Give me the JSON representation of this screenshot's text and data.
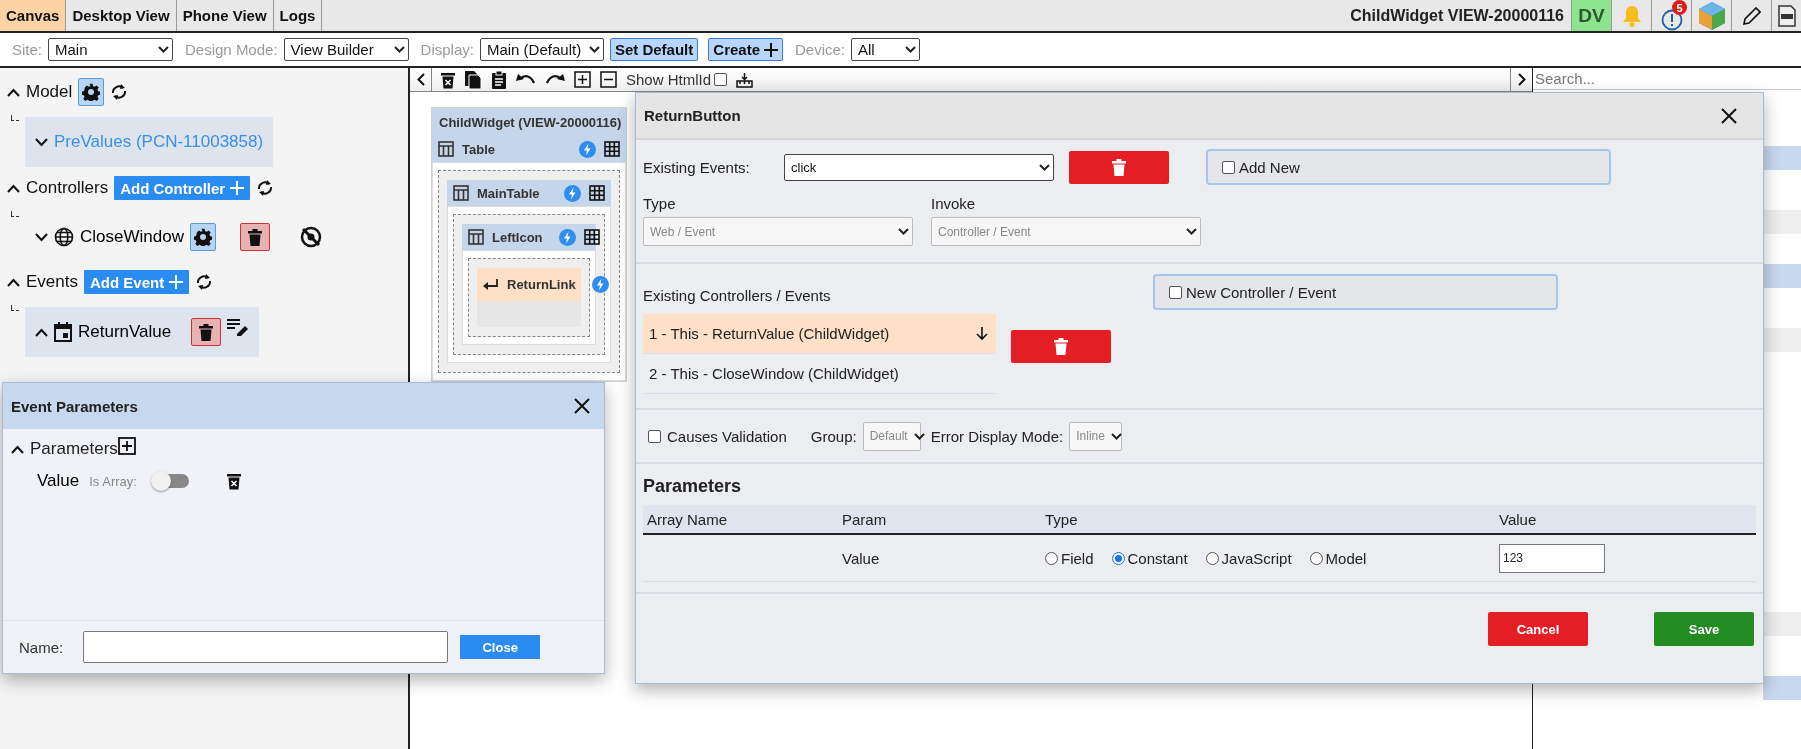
{
  "top_tabs": [
    {
      "label": "Canvas",
      "selected": true
    },
    {
      "label": "Desktop View",
      "selected": false
    },
    {
      "label": "Phone View",
      "selected": false
    },
    {
      "label": "Logs",
      "selected": false
    }
  ],
  "header": {
    "title": "ChildWidget VIEW-20000116",
    "user_initials": "DV",
    "alert_count": "5"
  },
  "options_bar": {
    "site": {
      "label": "Site:",
      "value": "Main"
    },
    "design_mode": {
      "label": "Design Mode:",
      "value": "View Builder"
    },
    "display": {
      "label": "Display:",
      "value": "Main (Default)"
    },
    "set_default": "Set Default",
    "create": "Create",
    "device": {
      "label": "Device:",
      "value": "All"
    }
  },
  "canvas_toolbar": {
    "show_htmlid": {
      "label": "Show HtmlId",
      "checked": false
    }
  },
  "left_panel": {
    "sections": [
      {
        "label": "Model",
        "expanded": true,
        "items": [
          {
            "label": "PreValues (PCN-11003858)",
            "expanded": false,
            "kind": "model"
          }
        ]
      },
      {
        "label": "Controllers",
        "expanded": true,
        "add_button": "Add Controller",
        "items": [
          {
            "label": "CloseWindow",
            "expanded": false,
            "kind": "controller"
          }
        ]
      },
      {
        "label": "Events",
        "expanded": true,
        "add_button": "Add Event",
        "items": [
          {
            "label": "ReturnValue",
            "expanded": true,
            "kind": "event"
          }
        ]
      }
    ]
  },
  "canvas": {
    "widget_title": "ChildWidget (VIEW-20000116)",
    "nodes": [
      {
        "label": "Table",
        "kind": "table",
        "children": [
          {
            "label": "MainTable",
            "kind": "table",
            "children": [
              {
                "label": "LeftIcon",
                "kind": "table",
                "children": [
                  {
                    "label": "ReturnLink",
                    "kind": "link"
                  }
                ]
              }
            ]
          }
        ]
      }
    ]
  },
  "right_panel": {
    "search": {
      "placeholder": "Search..."
    }
  },
  "event_parameters_dialog": {
    "title": "Event Parameters",
    "section": {
      "label": "Parameters",
      "expanded": true
    },
    "parameters": [
      {
        "name": "Value",
        "is_array_label": "Is Array:",
        "is_array": false
      }
    ],
    "name_field": {
      "label": "Name:"
    },
    "close_button": "Close"
  },
  "return_button_dialog": {
    "title": "ReturnButton",
    "existing_events": {
      "label": "Existing Events:",
      "value": "click"
    },
    "add_new": {
      "label": "Add New",
      "checked": false
    },
    "type": {
      "label": "Type",
      "value": "Web / Event",
      "disabled": true
    },
    "invoke": {
      "label": "Invoke",
      "value": "Controller / Event",
      "disabled": true
    },
    "existing_controllers": {
      "label": "Existing Controllers / Events",
      "items": [
        {
          "label": "1 - This - ReturnValue (ChildWidget)",
          "selected": true
        },
        {
          "label": "2 - This - CloseWindow (ChildWidget)",
          "selected": false
        }
      ]
    },
    "new_controller": {
      "label": "New Controller / Event",
      "checked": false
    },
    "causes_validation": {
      "label": "Causes Validation",
      "checked": false
    },
    "group": {
      "label": "Group:",
      "value": "Default"
    },
    "error_display_mode": {
      "label": "Error Display Mode:",
      "value": "Inline"
    },
    "parameters": {
      "title": "Parameters",
      "columns": [
        "Array Name",
        "Param",
        "Type",
        "Value"
      ],
      "rows": [
        {
          "param": "Value",
          "types": [
            {
              "label": "Field",
              "selected": false
            },
            {
              "label": "Constant",
              "selected": true
            },
            {
              "label": "JavaScript",
              "selected": false
            },
            {
              "label": "Model",
              "selected": false
            }
          ],
          "value": "123"
        }
      ]
    },
    "buttons": {
      "cancel": "Cancel",
      "save": "Save"
    }
  }
}
